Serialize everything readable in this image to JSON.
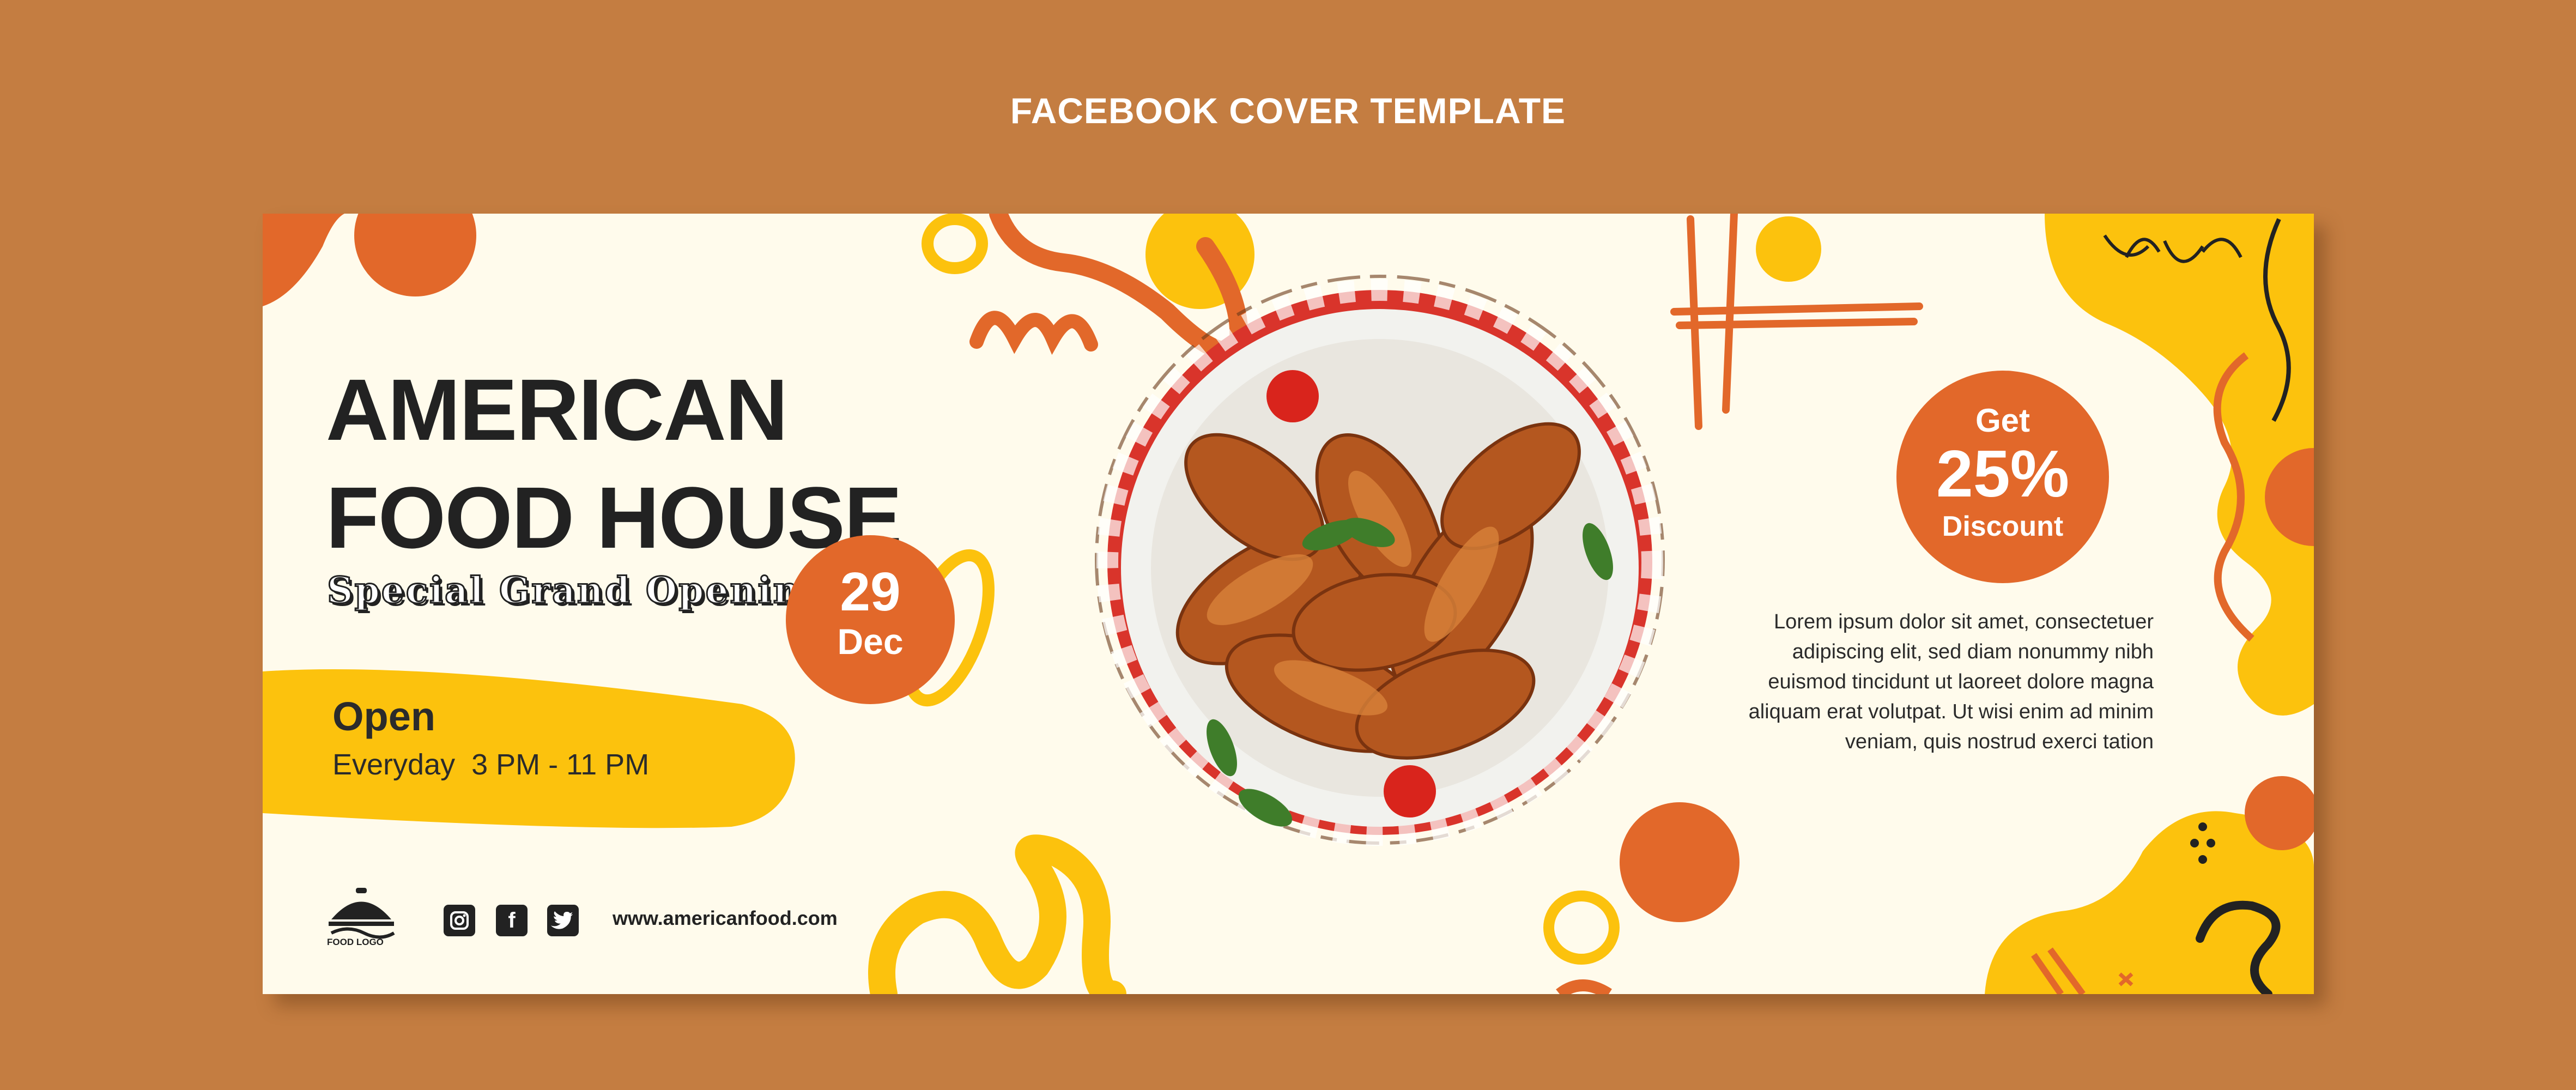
{
  "page_title": "FACEBOOK COVER TEMPLATE",
  "headline_line1": "AMERICAN",
  "headline_line2": "FOOD HOUSE",
  "subtitle": "Special Grand Opening",
  "date": {
    "day": "29",
    "month": "Dec"
  },
  "hours": {
    "label": "Open",
    "text": "Everyday  3 PM - 11 PM"
  },
  "discount": {
    "top": "Get",
    "value": "25%",
    "bottom": "Discount"
  },
  "body_lines": [
    "Lorem ipsum dolor sit amet, consectetuer",
    "adipiscing elit, sed diam nonummy nibh",
    "euismod tincidunt ut laoreet dolore magna",
    "aliquam erat volutpat. Ut wisi enim ad minim",
    "veniam, quis nostrud exerci tation"
  ],
  "logo_text": "FOOD LOGO",
  "social_icons": [
    "instagram-icon",
    "facebook-icon",
    "twitter-icon"
  ],
  "website": "www.americanfood.com",
  "colors": {
    "background": "#c47d41",
    "cover": "#fffbec",
    "orange": "#e2682a",
    "yellow": "#fcc20d",
    "text": "#222222"
  }
}
